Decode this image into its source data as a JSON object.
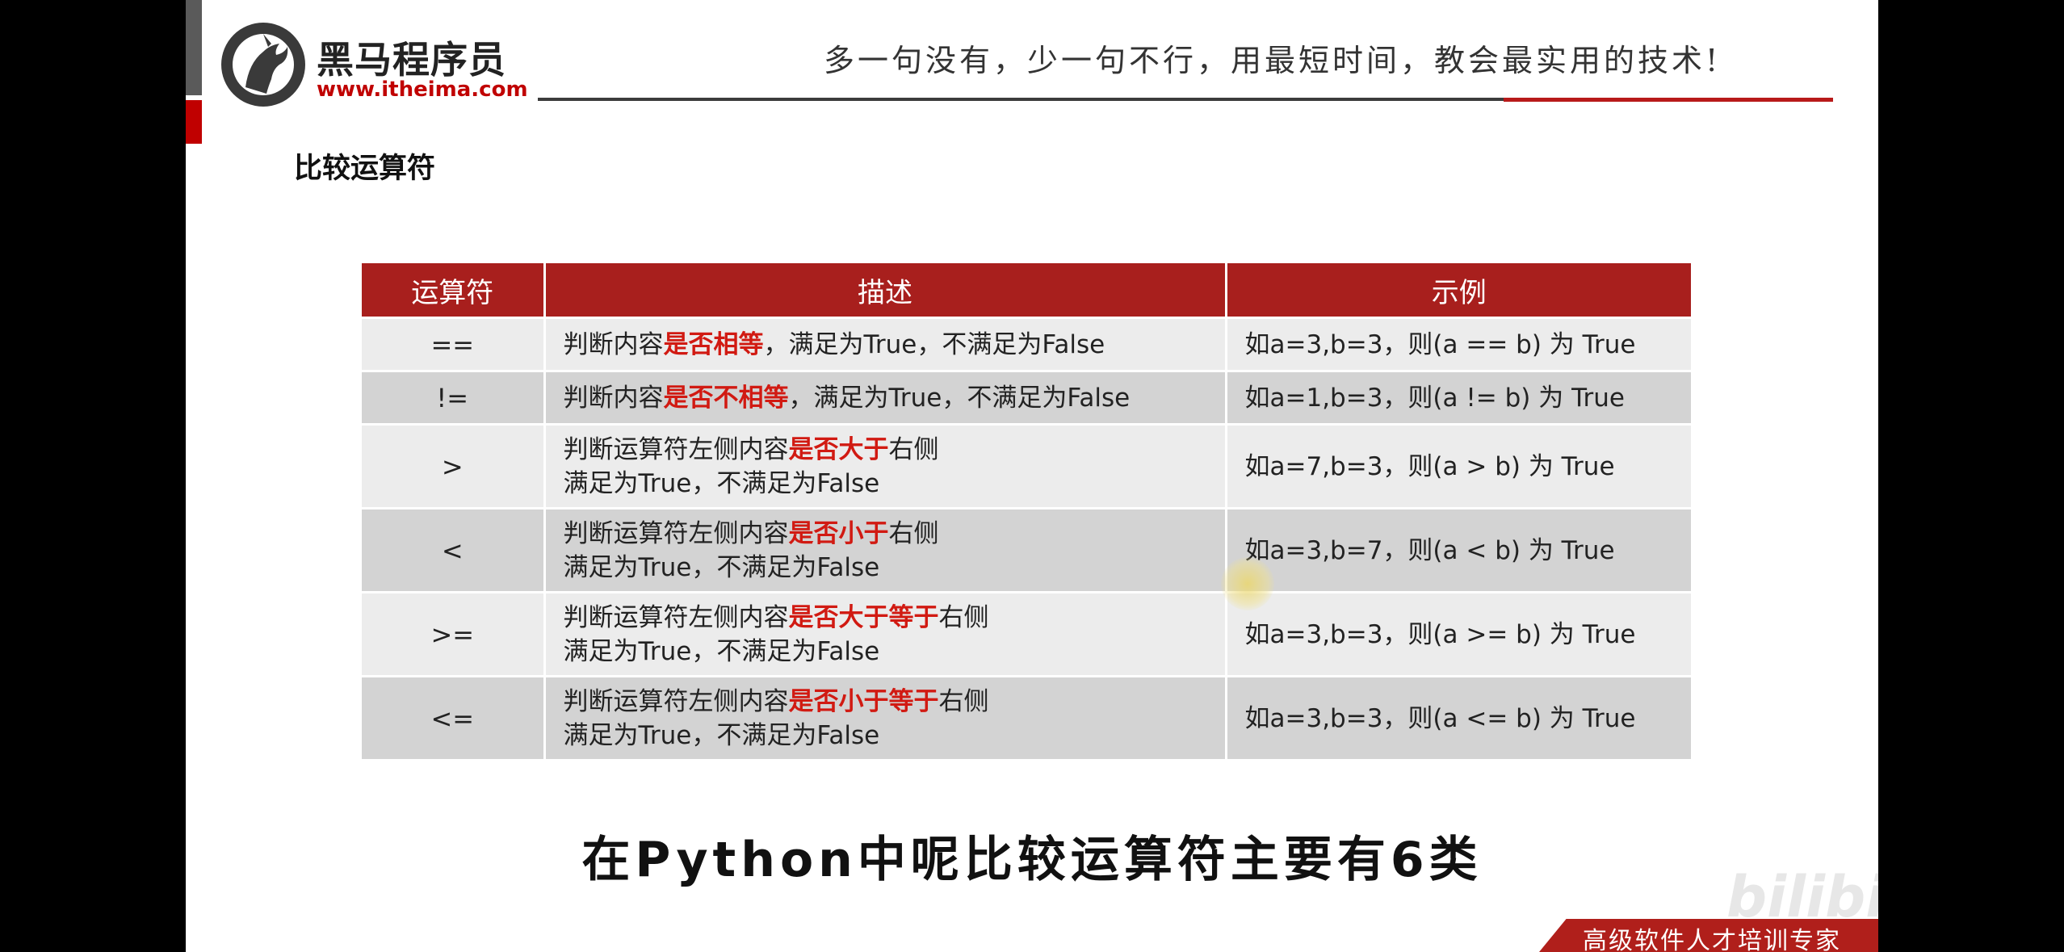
{
  "header": {
    "logo_name": "黑马程序员",
    "logo_url": "www.itheima.com",
    "motto": "多一句没有，少一句不行，用最短时间，教会最实用的技术!"
  },
  "section_title": "比较运算符",
  "table": {
    "headers": [
      "运算符",
      "描述",
      "示例"
    ],
    "rows": [
      {
        "op": "==",
        "desc_pre": "判断内容",
        "desc_hl": "是否相等",
        "desc_post": "，满足为True，不满足为False",
        "desc_line2": "",
        "example": "如a=3,b=3，则(a == b) 为 True"
      },
      {
        "op": "!=",
        "desc_pre": "判断内容",
        "desc_hl": "是否不相等",
        "desc_post": "，满足为True，不满足为False",
        "desc_line2": "",
        "example": "如a=1,b=3，则(a != b) 为 True"
      },
      {
        "op": ">",
        "desc_pre": "判断运算符左侧内容",
        "desc_hl": "是否大于",
        "desc_post": "右侧",
        "desc_line2": "满足为True，不满足为False",
        "example": "如a=7,b=3，则(a > b)  为 True"
      },
      {
        "op": "<",
        "desc_pre": "判断运算符左侧内容",
        "desc_hl": "是否小于",
        "desc_post": "右侧",
        "desc_line2": "满足为True，不满足为False",
        "example": "如a=3,b=7，则(a < b)  为 True"
      },
      {
        "op": ">=",
        "desc_pre": "判断运算符左侧内容",
        "desc_hl": "是否大于等于",
        "desc_post": "右侧",
        "desc_line2": "满足为True，不满足为False",
        "example": "如a=3,b=3，则(a >= b) 为 True"
      },
      {
        "op": "<=",
        "desc_pre": "判断运算符左侧内容",
        "desc_hl": "是否小于等于",
        "desc_post": "右侧",
        "desc_line2": "满足为True，不满足为False",
        "example": "如a=3,b=3，则(a <= b) 为 True"
      }
    ]
  },
  "subtitle": "在Python中呢比较运算符主要有6类",
  "watermark": "bilibili",
  "footer": "高级软件人才培训专家",
  "colors": {
    "brand_red": "#a81f1d",
    "highlight_red": "#d11a12",
    "row_light": "#ececec",
    "row_dark": "#d3d3d3"
  }
}
